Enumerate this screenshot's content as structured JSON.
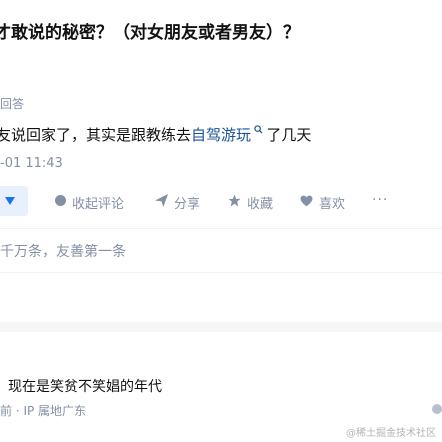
{
  "question": {
    "title": "才敢说的秘密？（对女朋友或者男友）？"
  },
  "answer": {
    "label": "回答",
    "text_before": "友说回家了，其实是跟教练去",
    "link_text": "自驾游玩",
    "link_icon": "search-icon",
    "text_after": "了几天",
    "time": "-01 11:43"
  },
  "actions": {
    "vote_icon": "triangle-down-icon",
    "collapse_comments": "收起评论",
    "share": "分享",
    "favorite": "收藏",
    "like": "喜欢",
    "more": "···"
  },
  "comments": {
    "count_text": "千万条，友善第一条",
    "first": {
      "text": "，现在是笑贫不笑娼的年代",
      "meta": "前 · IP 属地广东"
    }
  },
  "watermark": "@稀土掘金技术社区",
  "colors": {
    "link": "#175199",
    "accent": "#1772f6",
    "muted": "#8590a6",
    "vote_bg": "#e8f0fc"
  }
}
